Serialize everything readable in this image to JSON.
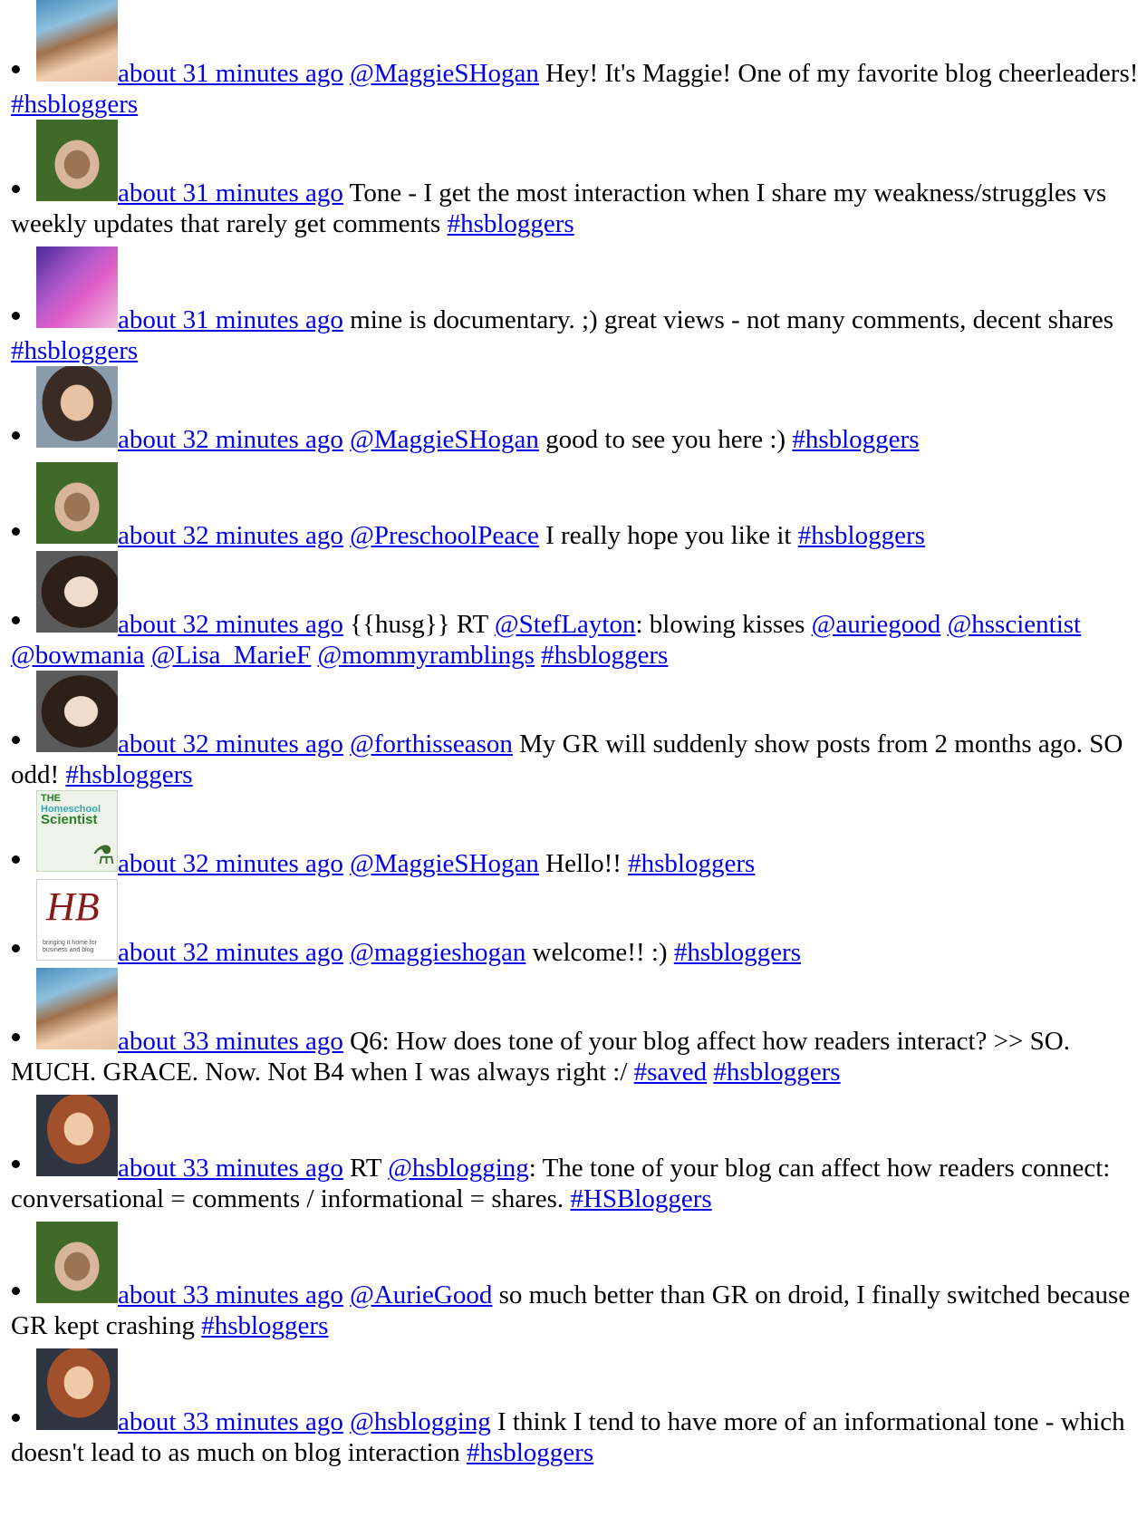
{
  "tweets": [
    {
      "avatar": "av-blonde",
      "time": "about 31 minutes ago",
      "parts": [
        {
          "t": "link",
          "v": "@MaggieSHogan"
        },
        {
          "t": "text",
          "v": " Hey! It's Maggie! One of my favorite blog cheerleaders! "
        },
        {
          "t": "link",
          "v": "#hsbloggers"
        }
      ]
    },
    {
      "avatar": "av-green",
      "time": "about 31 minutes ago",
      "parts": [
        {
          "t": "text",
          "v": "Tone - I get the most interaction when I share my weakness/struggles vs weekly updates that rarely get comments "
        },
        {
          "t": "link",
          "v": "#hsbloggers"
        }
      ]
    },
    {
      "avatar": "av-purple",
      "time": "about 31 minutes ago",
      "parts": [
        {
          "t": "text",
          "v": "mine is documentary. ;) great views - not many comments, decent shares "
        },
        {
          "t": "link",
          "v": "#hsbloggers"
        }
      ]
    },
    {
      "avatar": "av-dark",
      "time": "about 32 minutes ago",
      "parts": [
        {
          "t": "link",
          "v": "@MaggieSHogan"
        },
        {
          "t": "text",
          "v": " good to see you here :) "
        },
        {
          "t": "link",
          "v": "#hsbloggers"
        }
      ]
    },
    {
      "avatar": "av-green",
      "time": "about 32 minutes ago",
      "parts": [
        {
          "t": "link",
          "v": "@PreschoolPeace"
        },
        {
          "t": "text",
          "v": " I really hope you like it "
        },
        {
          "t": "link",
          "v": "#hsbloggers"
        }
      ]
    },
    {
      "avatar": "av-brunette",
      "time": "about 32 minutes ago",
      "parts": [
        {
          "t": "text",
          "v": "{{husg}} RT "
        },
        {
          "t": "link",
          "v": "@StefLayton"
        },
        {
          "t": "text",
          "v": ": blowing kisses "
        },
        {
          "t": "link",
          "v": "@auriegood"
        },
        {
          "t": "text",
          "v": " "
        },
        {
          "t": "link",
          "v": "@hsscientist"
        },
        {
          "t": "text",
          "v": " "
        },
        {
          "t": "link",
          "v": "@bowmania"
        },
        {
          "t": "text",
          "v": " "
        },
        {
          "t": "link",
          "v": "@Lisa_MarieF"
        },
        {
          "t": "text",
          "v": " "
        },
        {
          "t": "link",
          "v": "@mommyramblings"
        },
        {
          "t": "text",
          "v": " "
        },
        {
          "t": "link",
          "v": "#hsbloggers"
        }
      ]
    },
    {
      "avatar": "av-brunette",
      "time": "about 32 minutes ago",
      "parts": [
        {
          "t": "link",
          "v": "@forthisseason"
        },
        {
          "t": "text",
          "v": " My GR will suddenly show posts from 2 months ago. SO odd! "
        },
        {
          "t": "link",
          "v": "#hsbloggers"
        }
      ]
    },
    {
      "avatar": "av-logo1",
      "time": "about 32 minutes ago",
      "logo": {
        "l1": "THE",
        "l2": "Homeschool",
        "l3": "Scientist"
      },
      "parts": [
        {
          "t": "link",
          "v": "@MaggieSHogan"
        },
        {
          "t": "text",
          "v": " Hello!! "
        },
        {
          "t": "link",
          "v": "#hsbloggers"
        }
      ]
    },
    {
      "avatar": "av-logo2",
      "time": "about 32 minutes ago",
      "logo": {
        "l1": "HB",
        "l2": "bringing it home for business and blog"
      },
      "parts": [
        {
          "t": "link",
          "v": "@maggieshogan"
        },
        {
          "t": "text",
          "v": " welcome!! :) "
        },
        {
          "t": "link",
          "v": "#hsbloggers"
        }
      ]
    },
    {
      "avatar": "av-blonde",
      "time": "about 33 minutes ago",
      "parts": [
        {
          "t": "text",
          "v": "Q6: How does tone of your blog affect how readers interact? >> SO. MUCH. GRACE. Now. Not B4 when I was always right :/ "
        },
        {
          "t": "link",
          "v": "#saved"
        },
        {
          "t": "text",
          "v": " "
        },
        {
          "t": "link",
          "v": "#hsbloggers"
        }
      ]
    },
    {
      "avatar": "av-redhead",
      "time": "about 33 minutes ago",
      "parts": [
        {
          "t": "text",
          "v": "RT "
        },
        {
          "t": "link",
          "v": "@hsblogging"
        },
        {
          "t": "text",
          "v": ": The tone of your blog can affect how readers connect: conversational = comments / informational = shares. "
        },
        {
          "t": "link",
          "v": "#HSBloggers"
        }
      ]
    },
    {
      "avatar": "av-green",
      "time": "about 33 minutes ago",
      "parts": [
        {
          "t": "link",
          "v": "@AurieGood"
        },
        {
          "t": "text",
          "v": " so much better than GR on droid, I finally switched because GR kept crashing "
        },
        {
          "t": "link",
          "v": "#hsbloggers"
        }
      ]
    },
    {
      "avatar": "av-redhead",
      "time": "about 33 minutes ago",
      "parts": [
        {
          "t": "link",
          "v": "@hsblogging"
        },
        {
          "t": "text",
          "v": " I think I tend to have more of an informational tone - which doesn't lead to as much on blog interaction "
        },
        {
          "t": "link",
          "v": "#hsbloggers"
        }
      ]
    }
  ]
}
